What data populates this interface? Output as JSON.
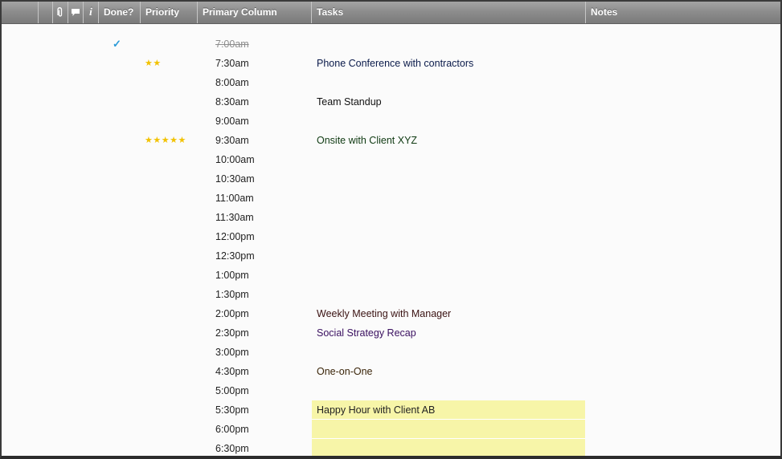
{
  "header": {
    "columns": {
      "attachment_icon": "paperclip-icon",
      "comment_icon": "comment-icon",
      "info_icon": "info-icon",
      "done": "Done?",
      "priority": "Priority",
      "primary": "Primary Column",
      "tasks": "Tasks",
      "notes": "Notes"
    }
  },
  "colors": {
    "header_bg": "#8d8d8d",
    "check": "#2a9ad8",
    "star": "#f2c200",
    "highlight": "#f7f5a8"
  },
  "rows": [
    {
      "done": "✓",
      "priority": "",
      "time": "7:00am",
      "task": "",
      "task_color": "#000000",
      "struck": true
    },
    {
      "done": "",
      "priority": "★★",
      "time": "7:30am",
      "task": "Phone Conference with contractors",
      "task_color": "#0a1a4a"
    },
    {
      "done": "",
      "priority": "",
      "time": "8:00am",
      "task": ""
    },
    {
      "done": "",
      "priority": "",
      "time": "8:30am",
      "task": "Team Standup",
      "task_color": "#111111"
    },
    {
      "done": "",
      "priority": "",
      "time": "9:00am",
      "task": ""
    },
    {
      "done": "",
      "priority": "★★★★★",
      "time": "9:30am",
      "task": "Onsite with Client XYZ",
      "task_color": "#0f3a12"
    },
    {
      "done": "",
      "priority": "",
      "time": "10:00am",
      "task": ""
    },
    {
      "done": "",
      "priority": "",
      "time": "10:30am",
      "task": ""
    },
    {
      "done": "",
      "priority": "",
      "time": "11:00am",
      "task": ""
    },
    {
      "done": "",
      "priority": "",
      "time": "11:30am",
      "task": ""
    },
    {
      "done": "",
      "priority": "",
      "time": "12:00pm",
      "task": ""
    },
    {
      "done": "",
      "priority": "",
      "time": "12:30pm",
      "task": ""
    },
    {
      "done": "",
      "priority": "",
      "time": "1:00pm",
      "task": ""
    },
    {
      "done": "",
      "priority": "",
      "time": "1:30pm",
      "task": ""
    },
    {
      "done": "",
      "priority": "",
      "time": "2:00pm",
      "task": "Weekly Meeting with Manager",
      "task_color": "#3a1212"
    },
    {
      "done": "",
      "priority": "",
      "time": "2:30pm",
      "task": "Social Strategy Recap",
      "task_color": "#3a1060"
    },
    {
      "done": "",
      "priority": "",
      "time": "3:00pm",
      "task": ""
    },
    {
      "done": "",
      "priority": "",
      "time": "4:30pm",
      "task": "One-on-One",
      "task_color": "#3a2408"
    },
    {
      "done": "",
      "priority": "",
      "time": "5:00pm",
      "task": ""
    },
    {
      "done": "",
      "priority": "",
      "time": "5:30pm",
      "task": "Happy Hour with Client AB",
      "task_color": "#222222",
      "highlight": true
    },
    {
      "done": "",
      "priority": "",
      "time": "6:00pm",
      "task": "",
      "highlight": true
    },
    {
      "done": "",
      "priority": "",
      "time": "6:30pm",
      "task": "",
      "highlight": true
    }
  ]
}
